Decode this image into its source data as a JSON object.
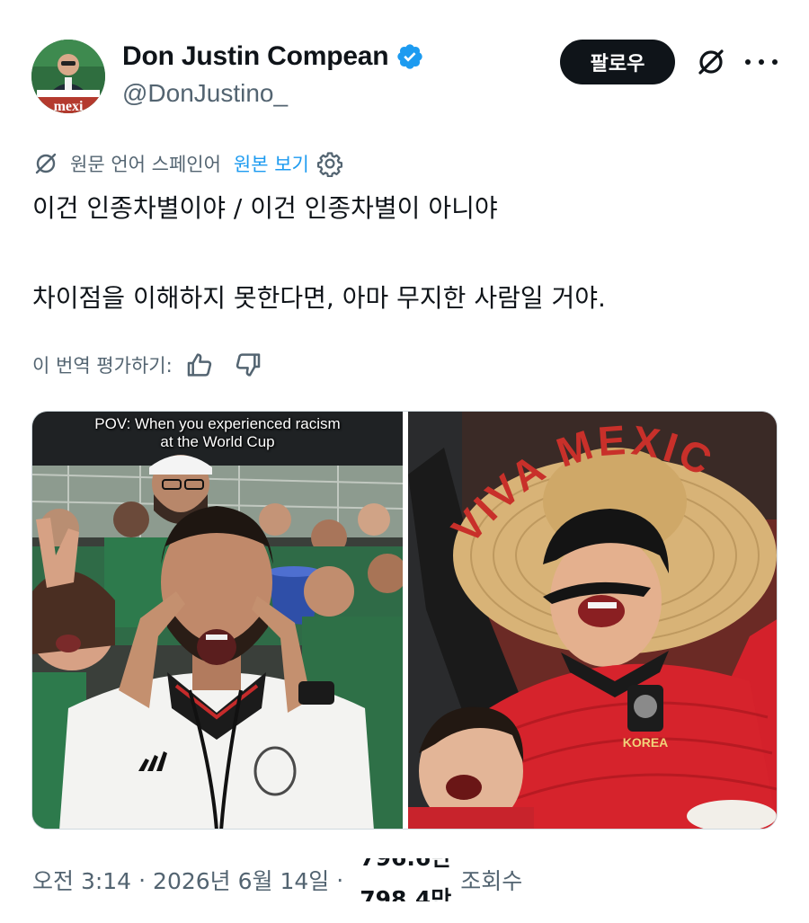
{
  "author": {
    "display_name": "Don Justin Compean",
    "handle": "@DonJustino_",
    "avatar_banner_text": "mexi"
  },
  "actions": {
    "follow_label": "팔로우",
    "grok_icon": "grok-slash-icon",
    "more_icon": "more-dots-icon"
  },
  "translation": {
    "source_language": "원문 언어 스페인어",
    "view_original": "원본 보기",
    "rate_label": "이 번역 평가하기:"
  },
  "tweet": {
    "line1": "이건 인종차별이야 / 이건 인종차별이 아니야",
    "line2": "차이점을 이해하지 못한다면, 아마 무지한 사람일 거야."
  },
  "media": {
    "caption_line1": "POV: When you experienced racism",
    "caption_line2": "at the World Cup",
    "left_image": "Mexico fan pulling eyes at World Cup stadium",
    "right_image": "Korea fan wearing sombrero and fake mustache",
    "hat_text": "VIVA MEXICO",
    "jersey_text": "KOREA"
  },
  "footer": {
    "time": "오전 3:14",
    "separator": "·",
    "date": "2026년 6월 14일",
    "separator2": "·",
    "views_prev": "796.6만",
    "views": "798.4만",
    "views_label": "조회수"
  },
  "colors": {
    "accent": "#1d9bf0",
    "text": "#0f1419",
    "muted": "#536471",
    "button_bg": "#0f1419"
  }
}
